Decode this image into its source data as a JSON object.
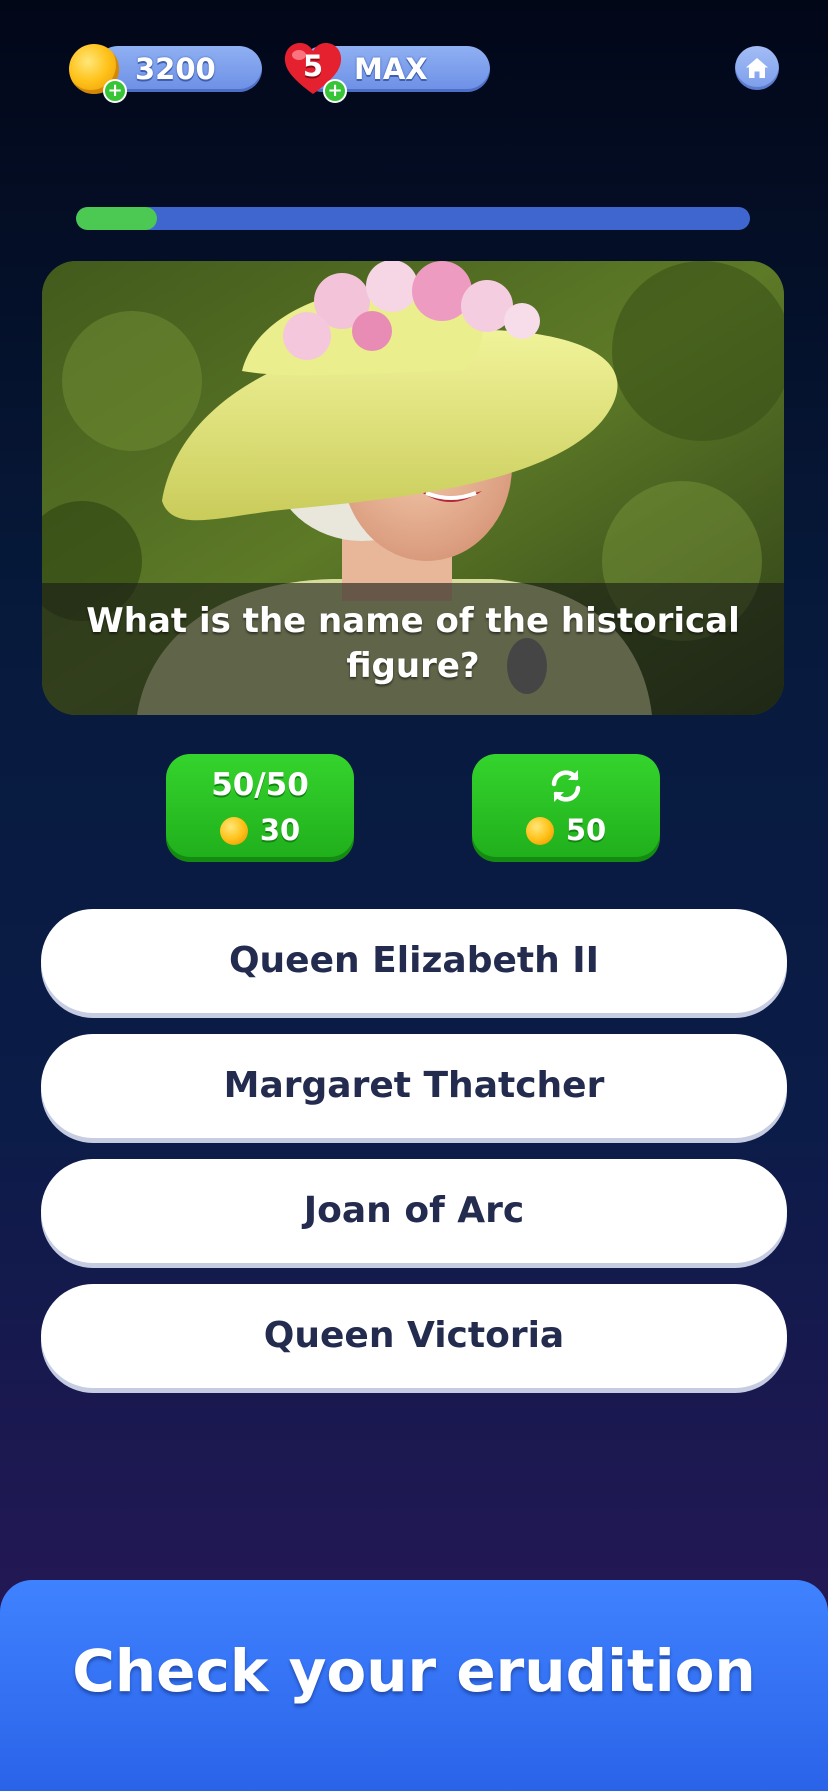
{
  "hud": {
    "coins": "3200",
    "lives_count": "5",
    "lives_status": "MAX",
    "home_icon": "home-icon",
    "add_icon": "plus-icon"
  },
  "progress": {
    "fraction": 0.12
  },
  "question": {
    "text": "What is the name of the historical figure?"
  },
  "hints": {
    "fifty_fifty_label": "50/50",
    "fifty_fifty_cost": "30",
    "swap_icon": "refresh-icon",
    "swap_cost": "50"
  },
  "answers": [
    "Queen Elizabeth II",
    "Margaret Thatcher",
    "Joan of Arc",
    "Queen Victoria"
  ],
  "banner": {
    "text": "Check your erudition"
  },
  "colors": {
    "progress_fill": "#4bc953",
    "progress_track": "#3f66cf",
    "hint_green": "#28c022",
    "banner_blue": "#3474f5"
  }
}
